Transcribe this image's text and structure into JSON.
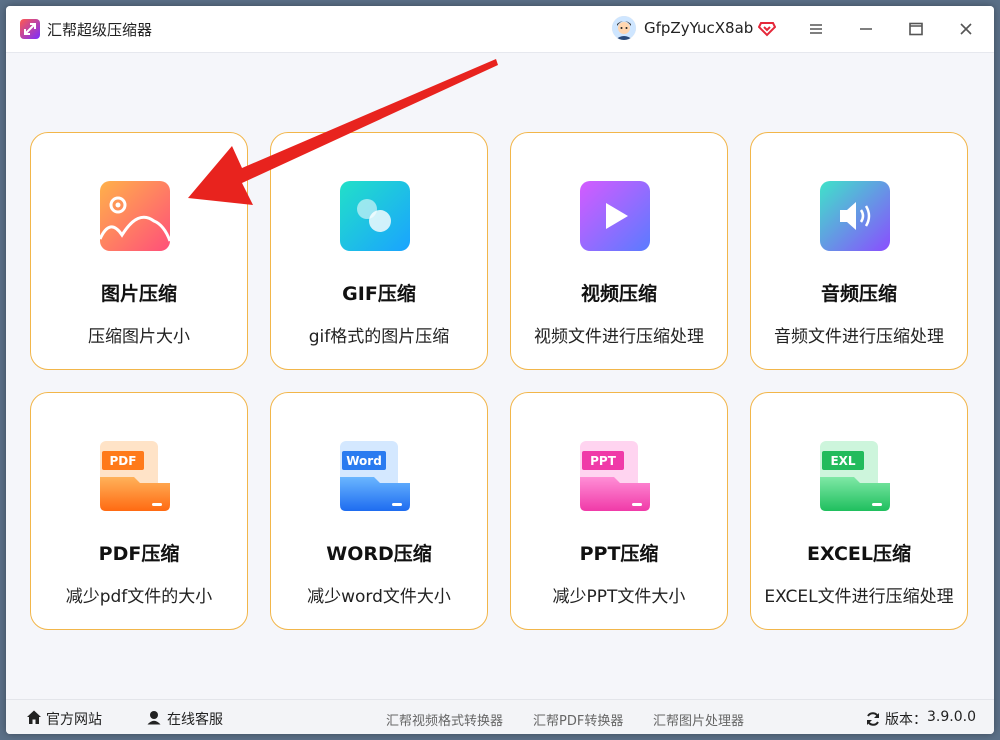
{
  "app": {
    "title": "汇帮超级压缩器"
  },
  "user": {
    "name": "GfpZyYucX8ab"
  },
  "colors": {
    "card_border": "#f2b64a",
    "arrow": "#e8231e"
  },
  "cards": [
    {
      "title": "图片压缩",
      "desc": "压缩图片大小",
      "icon": "image-icon"
    },
    {
      "title": "GIF压缩",
      "desc": "gif格式的图片压缩",
      "icon": "gif-icon"
    },
    {
      "title": "视频压缩",
      "desc": "视频文件进行压缩处理",
      "icon": "video-icon"
    },
    {
      "title": "音频压缩",
      "desc": "音频文件进行压缩处理",
      "icon": "audio-icon"
    },
    {
      "title": "PDF压缩",
      "desc": "减少pdf文件的大小",
      "icon": "pdf-folder-icon",
      "badge": "PDF"
    },
    {
      "title": "WORD压缩",
      "desc": "减少word文件大小",
      "icon": "word-folder-icon",
      "badge": "Word"
    },
    {
      "title": "PPT压缩",
      "desc": "减少PPT文件大小",
      "icon": "ppt-folder-icon",
      "badge": "PPT"
    },
    {
      "title": "EXCEL压缩",
      "desc": "EXCEL文件进行压缩处理",
      "icon": "excel-folder-icon",
      "badge": "EXL"
    }
  ],
  "footer": {
    "website": "官方网站",
    "support": "在线客服",
    "links": [
      "汇帮视频格式转换器",
      "汇帮PDF转换器",
      "汇帮图片处理器"
    ],
    "version_label": "版本：",
    "version": "3.9.0.0"
  }
}
